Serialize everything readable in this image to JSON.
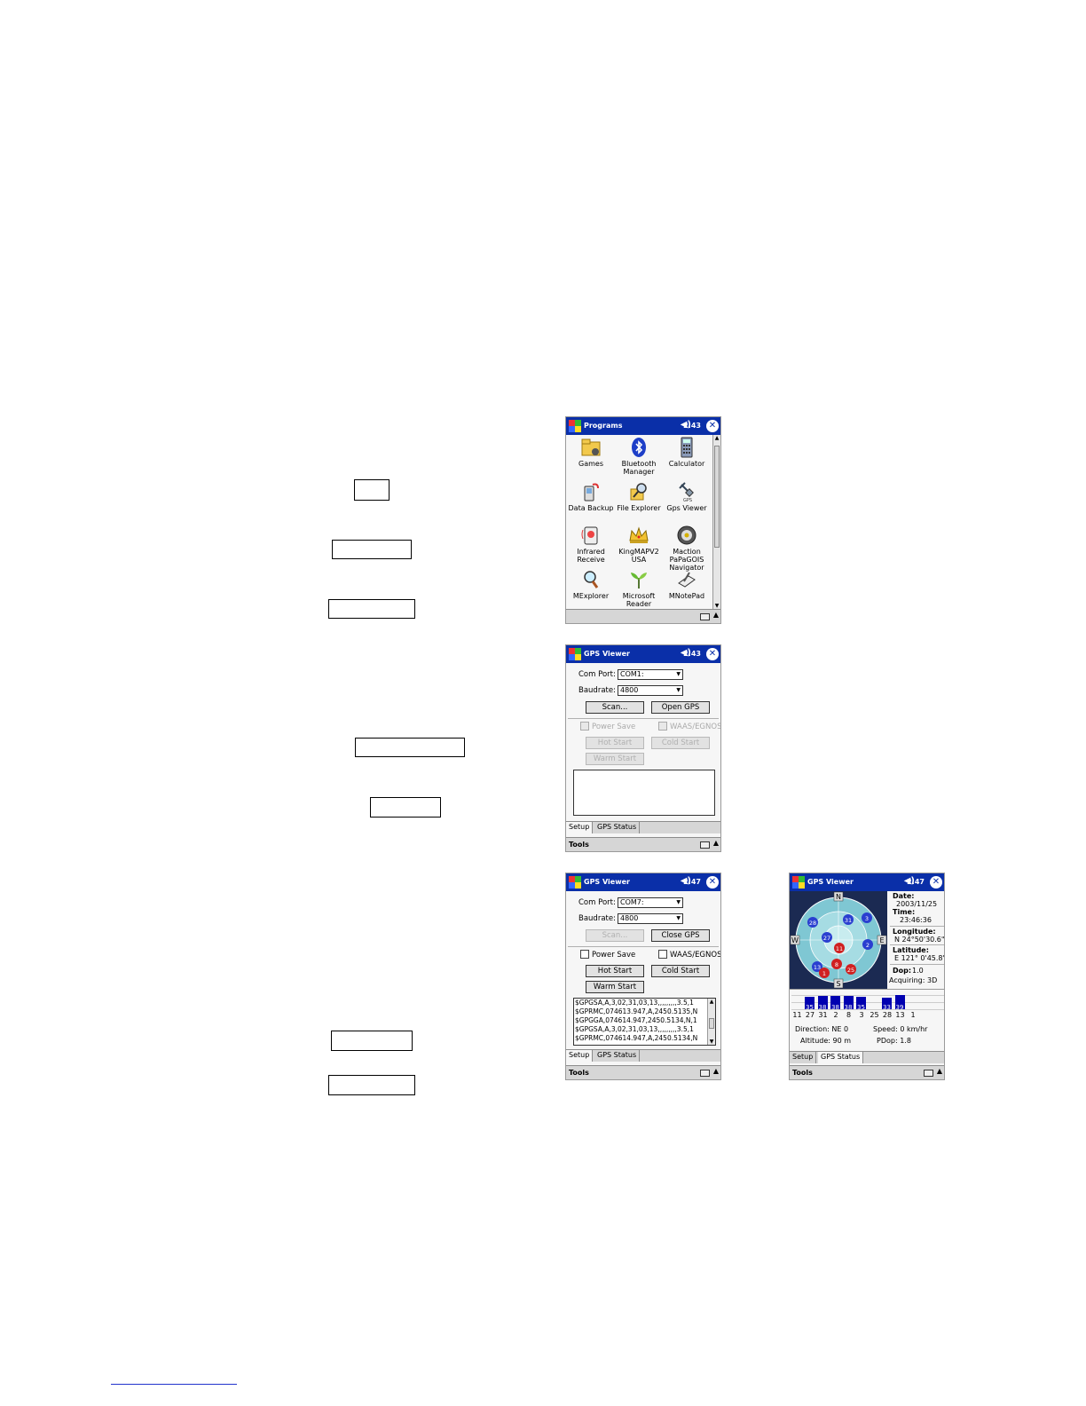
{
  "screen1": {
    "title": "Programs",
    "time": "2:43",
    "programs": [
      {
        "label": "Games"
      },
      {
        "label": "Bluetooth Manager"
      },
      {
        "label": "Calculator"
      },
      {
        "label": "Data Backup"
      },
      {
        "label": "File Explorer"
      },
      {
        "label": "Gps Viewer"
      },
      {
        "label": "Infrared Receive"
      },
      {
        "label": "KingMAPV2 USA"
      },
      {
        "label": "Maction PaPaGOIS Navigator"
      },
      {
        "label": "MExplorer"
      },
      {
        "label": "Microsoft Reader"
      },
      {
        "label": "MNotePad"
      }
    ]
  },
  "screen2": {
    "title": "GPS Viewer",
    "time": "2:43",
    "com_port_label": "Com Port:",
    "com_port_value": "COM1:",
    "baudrate_label": "Baudrate:",
    "baudrate_value": "4800",
    "scan_label": "Scan...",
    "gps_button_label": "Open GPS",
    "power_save_label": "Power Save",
    "waas_label": "WAAS/EGNOS",
    "hot_start_label": "Hot Start",
    "cold_start_label": "Cold Start",
    "warm_start_label": "Warm Start",
    "tab_setup": "Setup",
    "tab_gps_status": "GPS Status",
    "tools_label": "Tools"
  },
  "screen3": {
    "title": "GPS Viewer",
    "time": "2:47",
    "com_port_label": "Com Port:",
    "com_port_value": "COM7:",
    "baudrate_label": "Baudrate:",
    "baudrate_value": "4800",
    "scan_label": "Scan...",
    "gps_button_label": "Close GPS",
    "power_save_label": "Power Save",
    "waas_label": "WAAS/EGNOS",
    "hot_start_label": "Hot Start",
    "cold_start_label": "Cold Start",
    "warm_start_label": "Warm Start",
    "log_lines": [
      "$GPGSA,A,3,02,31,03,13,,,,,,,,,3.5,1",
      "$GPRMC,074613.947,A,2450.5135,N",
      "$GPGGA,074614.947,2450.5134,N,1",
      "$GPGSA,A,3,02,31,03,13,,,,,,,,,3.5,1",
      "$GPRMC,074614.947,A,2450.5134,N"
    ],
    "tab_setup": "Setup",
    "tab_gps_status": "GPS Status",
    "tools_label": "Tools"
  },
  "screen4": {
    "title": "GPS Viewer",
    "time": "2:47",
    "compass": {
      "n": "N",
      "s": "S",
      "e": "E",
      "w": "W"
    },
    "satellites_blue": [
      "28",
      "31",
      "3",
      "27",
      "2",
      "13"
    ],
    "satellites_red": [
      "11",
      "8",
      "1",
      "25"
    ],
    "date_label": "Date:",
    "date_value": "2003/11/25",
    "time_label": "Time:",
    "time_value": "23:46:36",
    "longitude_label": "Longitude:",
    "longitude_value": "N  24°50'30.6\"",
    "latitude_label": "Latitude:",
    "latitude_value": "E 121° 0'45.8\"",
    "dop_label": "Dop:",
    "dop_value": "1.0",
    "acquiring_label": "Acquiring: 3D",
    "signal_bars": [
      {
        "prn": "11",
        "level": 0
      },
      {
        "prn": "27",
        "level": 35
      },
      {
        "prn": "31",
        "level": 38
      },
      {
        "prn": "2",
        "level": 38
      },
      {
        "prn": "8",
        "level": 38
      },
      {
        "prn": "3",
        "level": 35
      },
      {
        "prn": "25",
        "level": 0
      },
      {
        "prn": "28",
        "level": 33
      },
      {
        "prn": "13",
        "level": 39
      },
      {
        "prn": "1",
        "level": 0
      }
    ],
    "direction_label": "Direction: NE 0",
    "speed_label": "Speed: 0 km/hr",
    "altitude_label": "Altitude: 90 m",
    "pdop_label": "PDop: 1.8",
    "tab_setup": "Setup",
    "tab_gps_status": "GPS Status",
    "tools_label": "Tools"
  }
}
